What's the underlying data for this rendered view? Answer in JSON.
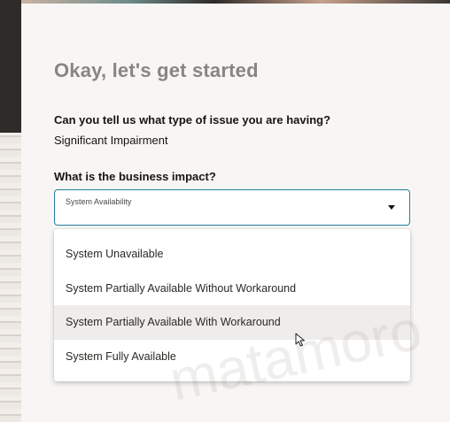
{
  "header": {
    "title": "Okay, let's get started"
  },
  "issue_type": {
    "question": "Can you tell us what type of issue you are having?",
    "answer": "Significant Impairment"
  },
  "business_impact": {
    "question": "What is the business impact?",
    "selected": "System Availability",
    "options": [
      {
        "label": "System Unavailable"
      },
      {
        "label": "System Partially Available Without Workaround"
      },
      {
        "label": "System Partially Available With Workaround",
        "hovered": true
      },
      {
        "label": "System Fully Available"
      }
    ]
  },
  "watermark": "matamoro",
  "colors": {
    "accent_border": "#227e9e",
    "title": "#8a8580",
    "hover_bg": "#efedeb"
  }
}
